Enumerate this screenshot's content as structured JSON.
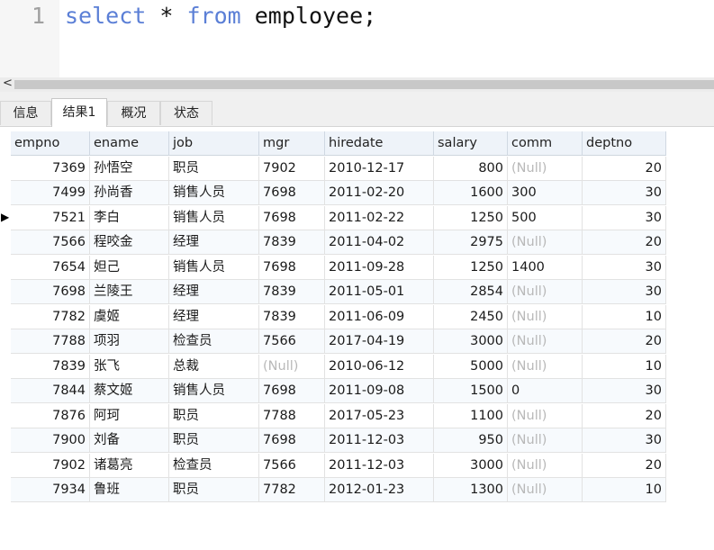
{
  "editor": {
    "line_number": "1",
    "keyword_select": "select",
    "star": " * ",
    "keyword_from": "from",
    "rest": " employee;"
  },
  "scrollbar": {
    "left_arrow": "<"
  },
  "tabs": [
    {
      "label": "信息",
      "active": false
    },
    {
      "label": "结果1",
      "active": true
    },
    {
      "label": "概况",
      "active": false
    },
    {
      "label": "状态",
      "active": false
    }
  ],
  "table": {
    "columns": [
      "empno",
      "ename",
      "job",
      "mgr",
      "hiredate",
      "salary",
      "comm",
      "deptno"
    ],
    "selected_row": 2,
    "rows": [
      [
        "7369",
        "孙悟空",
        "职员",
        "7902",
        "2010-12-17",
        "800",
        "(Null)",
        "20"
      ],
      [
        "7499",
        "孙尚香",
        "销售人员",
        "7698",
        "2011-02-20",
        "1600",
        "300",
        "30"
      ],
      [
        "7521",
        "李白",
        "销售人员",
        "7698",
        "2011-02-22",
        "1250",
        "500",
        "30"
      ],
      [
        "7566",
        "程咬金",
        "经理",
        "7839",
        "2011-04-02",
        "2975",
        "(Null)",
        "20"
      ],
      [
        "7654",
        "妲己",
        "销售人员",
        "7698",
        "2011-09-28",
        "1250",
        "1400",
        "30"
      ],
      [
        "7698",
        "兰陵王",
        "经理",
        "7839",
        "2011-05-01",
        "2854",
        "(Null)",
        "30"
      ],
      [
        "7782",
        "虞姬",
        "经理",
        "7839",
        "2011-06-09",
        "2450",
        "(Null)",
        "10"
      ],
      [
        "7788",
        "项羽",
        "检查员",
        "7566",
        "2017-04-19",
        "3000",
        "(Null)",
        "20"
      ],
      [
        "7839",
        "张飞",
        "总裁",
        "(Null)",
        "2010-06-12",
        "5000",
        "(Null)",
        "10"
      ],
      [
        "7844",
        "蔡文姬",
        "销售人员",
        "7698",
        "2011-09-08",
        "1500",
        "0",
        "30"
      ],
      [
        "7876",
        "阿珂",
        "职员",
        "7788",
        "2017-05-23",
        "1100",
        "(Null)",
        "20"
      ],
      [
        "7900",
        "刘备",
        "职员",
        "7698",
        "2011-12-03",
        "950",
        "(Null)",
        "30"
      ],
      [
        "7902",
        "诸葛亮",
        "检查员",
        "7566",
        "2011-12-03",
        "3000",
        "(Null)",
        "20"
      ],
      [
        "7934",
        "鲁班",
        "职员",
        "7782",
        "2012-01-23",
        "1300",
        "(Null)",
        "10"
      ]
    ]
  },
  "colors": {
    "keyword": "#5b7fd6",
    "null_text": "#b8b8b8",
    "header_bg": "#eef3f9"
  }
}
